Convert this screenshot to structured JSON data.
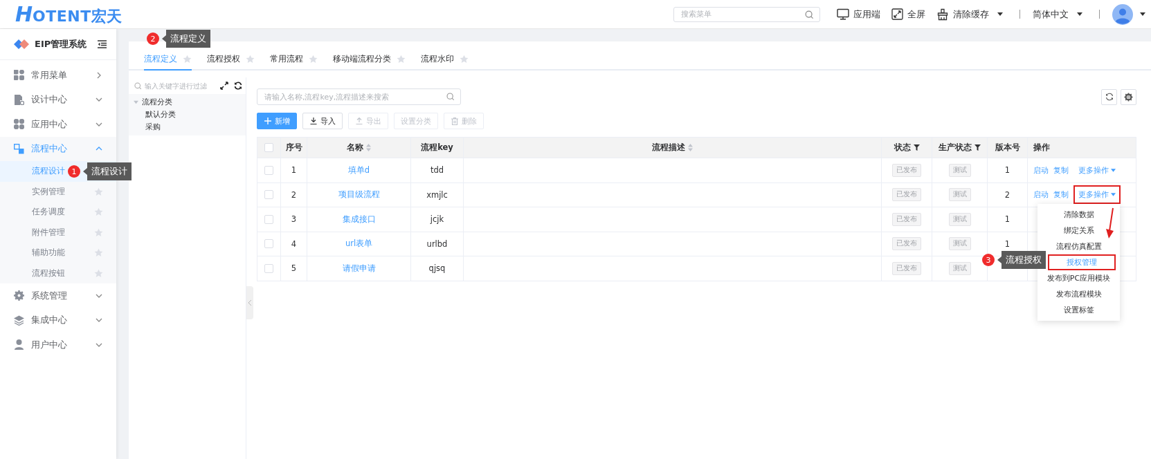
{
  "header": {
    "logo_mark": "H",
    "logo_text": "OTENT宏天",
    "search_placeholder": "搜索菜单",
    "actions": [
      {
        "label": "应用端",
        "dropdown": false
      },
      {
        "label": "全屏",
        "dropdown": false
      },
      {
        "label": "清除缓存",
        "dropdown": true
      }
    ],
    "language": "简体中文"
  },
  "sidebar": {
    "title": "EIP管理系统",
    "items": [
      {
        "label": "常用菜单",
        "kind": "flyout",
        "expanded": false
      },
      {
        "label": "设计中心",
        "kind": "group",
        "expanded": false
      },
      {
        "label": "应用中心",
        "kind": "group",
        "expanded": false
      },
      {
        "label": "流程中心",
        "kind": "group",
        "expanded": true,
        "children": [
          {
            "label": "流程设计",
            "selected": true
          },
          {
            "label": "实例管理",
            "selected": false
          },
          {
            "label": "任务调度",
            "selected": false
          },
          {
            "label": "附件管理",
            "selected": false
          },
          {
            "label": "辅助功能",
            "selected": false
          },
          {
            "label": "流程按钮",
            "selected": false
          }
        ]
      },
      {
        "label": "系统管理",
        "kind": "group",
        "expanded": false
      },
      {
        "label": "集成中心",
        "kind": "group",
        "expanded": false
      },
      {
        "label": "用户中心",
        "kind": "group",
        "expanded": false
      }
    ]
  },
  "tabs": [
    {
      "label": "流程定义",
      "selected": true
    },
    {
      "label": "流程授权",
      "selected": false
    },
    {
      "label": "常用流程",
      "selected": false
    },
    {
      "label": "移动端流程分类",
      "selected": false
    },
    {
      "label": "流程水印",
      "selected": false
    }
  ],
  "tree": {
    "filter_placeholder": "输入关键字进行过滤",
    "root": {
      "label": "流程分类",
      "expanded": true,
      "children": [
        {
          "label": "默认分类"
        },
        {
          "label": "采购"
        }
      ]
    }
  },
  "toolbar": {
    "search_placeholder": "请输入名称,流程key,流程描述来搜索",
    "buttons": [
      {
        "label": "新增",
        "kind": "primary",
        "disabled": false
      },
      {
        "label": "导入",
        "kind": "default",
        "disabled": false
      },
      {
        "label": "导出",
        "kind": "default",
        "disabled": true
      },
      {
        "label": "设置分类",
        "kind": "default",
        "disabled": true
      },
      {
        "label": "删除",
        "kind": "default",
        "disabled": true
      }
    ]
  },
  "table": {
    "all_checked": false,
    "columns": [
      {
        "label": "序号",
        "sortable": false,
        "filter": false
      },
      {
        "label": "名称",
        "sortable": true,
        "filter": false
      },
      {
        "label": "流程key",
        "sortable": false,
        "filter": false
      },
      {
        "label": "流程描述",
        "sortable": true,
        "filter": false
      },
      {
        "label": "状态",
        "sortable": false,
        "filter": true
      },
      {
        "label": "生产状态",
        "sortable": false,
        "filter": true
      },
      {
        "label": "版本号",
        "sortable": false,
        "filter": false
      },
      {
        "label": "操作",
        "sortable": false,
        "filter": false
      }
    ],
    "rows": [
      {
        "checked": false,
        "index": "1",
        "name": "填单d",
        "key": "tdd",
        "status": "已发布",
        "prod_status": "测试",
        "version": "1",
        "actions": [
          "启动",
          "复制"
        ],
        "more": "更多操作",
        "highlighted": false
      },
      {
        "checked": false,
        "index": "2",
        "name": "项目级流程",
        "key": "xmjlc",
        "status": "已发布",
        "prod_status": "测试",
        "version": "2",
        "actions": [
          "启动",
          "复制"
        ],
        "more": "更多操作",
        "highlighted": true
      },
      {
        "checked": false,
        "index": "3",
        "name": "集成接口",
        "key": "jcjk",
        "status": "已发布",
        "prod_status": "测试",
        "version": "1"
      },
      {
        "checked": false,
        "index": "4",
        "name": "url表单",
        "key": "urlbd",
        "status": "已发布",
        "prod_status": "测试",
        "version": "1"
      },
      {
        "checked": false,
        "index": "5",
        "name": "请假申请",
        "key": "qjsq",
        "status": "已发布",
        "prod_status": "测试"
      }
    ]
  },
  "more_menu": {
    "items": [
      {
        "label": "清除数据",
        "selected": false
      },
      {
        "label": "绑定关系",
        "selected": false
      },
      {
        "label": "流程仿真配置",
        "selected": false
      },
      {
        "label": "授权管理",
        "selected": true
      },
      {
        "label": "发布到PC应用模块",
        "selected": false
      },
      {
        "label": "发布流程模块",
        "selected": false
      },
      {
        "label": "设置标签",
        "selected": false
      }
    ]
  },
  "annotations": [
    {
      "number": "1",
      "text": "流程设计"
    },
    {
      "number": "2",
      "text": "流程定义"
    },
    {
      "number": "3",
      "text": "流程授权"
    }
  ]
}
